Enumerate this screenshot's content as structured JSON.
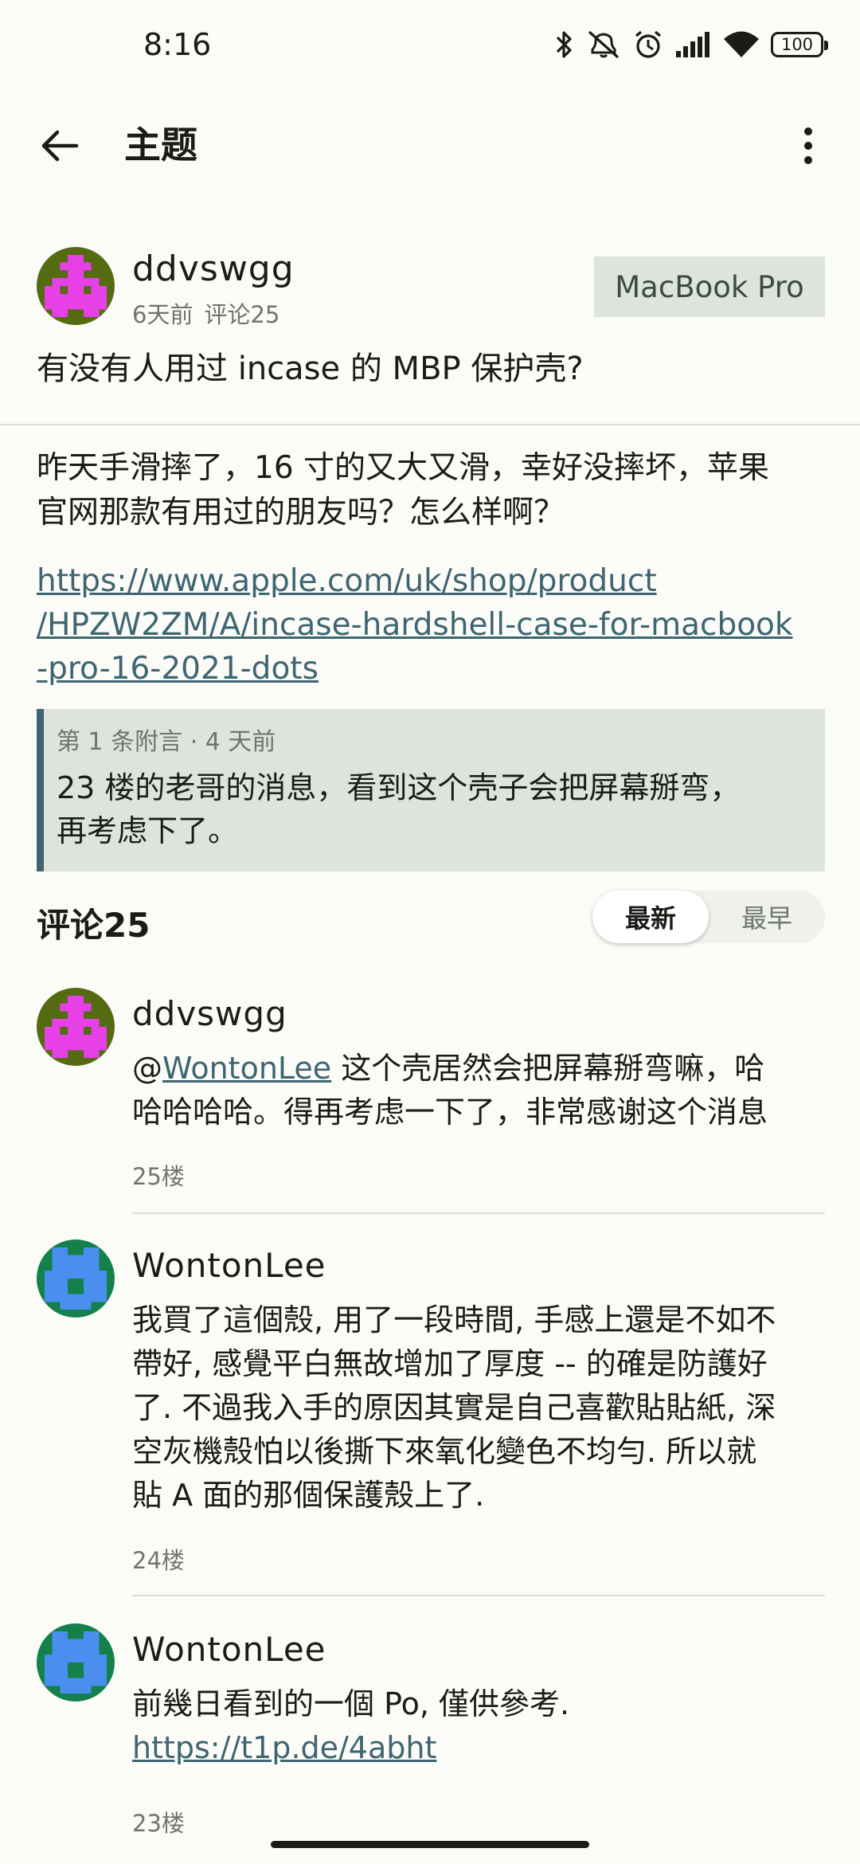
{
  "status_bar": {
    "time": "8:16",
    "battery": "100"
  },
  "app_bar": {
    "title": "主题"
  },
  "topic": {
    "author": "ddvswgg",
    "time_ago": "6天前",
    "comment_count": "评论25",
    "node": "MacBook Pro",
    "title": "有没有人用过 incase 的 MBP 保护壳?",
    "content_line1": "昨天手滑摔了，16 寸的又大又滑，幸好没摔坏，苹果",
    "content_line2": "官网那款有用过的朋友吗？怎么样啊？",
    "link_line1": "https://www.apple.com/uk/shop/product",
    "link_line2": "/HPZW2ZM/A/incase-hardshell-case-for-macbook",
    "link_line3": "-pro-16-2021-dots",
    "supplement": {
      "meta": "第 1 条附言 · 4 天前",
      "text_line1": " 23 楼的老哥的消息，看到这个壳子会把屏幕掰弯，",
      "text_line2": "再考虑下了。"
    }
  },
  "comments_section": {
    "title": "评论25",
    "sort_newest": "最新",
    "sort_oldest": "最早"
  },
  "comments": [
    {
      "author": "ddvswgg",
      "mention": "@",
      "mention_user": "WontonLee",
      "text_after_mention": " 这个壳居然会把屏幕掰弯嘛，哈",
      "line2": "哈哈哈哈。得再考虑一下了，非常感谢这个消息",
      "floor": "25楼"
    },
    {
      "author": "WontonLee",
      "lines": [
        "我買了這個殼, 用了一段時間, 手感上還是不如不",
        "帶好, 感覺平白無故增加了厚度 -- 的確是防護好",
        "了. 不過我入手的原因其實是自己喜歡貼貼紙, 深",
        "空灰機殼怕以後撕下來氧化變色不均勻. 所以就",
        "貼 A 面的那個保護殼上了."
      ],
      "floor": "24楼"
    },
    {
      "author": "WontonLee",
      "line1": "前幾日看到的一個 Po, 僅供參考.",
      "link": "https://t1p.de/4abht",
      "floor": "23楼"
    }
  ],
  "colors": {
    "background": "#fbfcf8",
    "accent": "#3f6570",
    "tag_bg": "#dce4dc",
    "muted_text": "#6f746d"
  },
  "icons": [
    "bluetooth-icon",
    "mute-icon",
    "alarm-icon",
    "signal-icon",
    "wifi-icon",
    "battery-icon",
    "back-arrow-icon",
    "more-vert-icon"
  ]
}
